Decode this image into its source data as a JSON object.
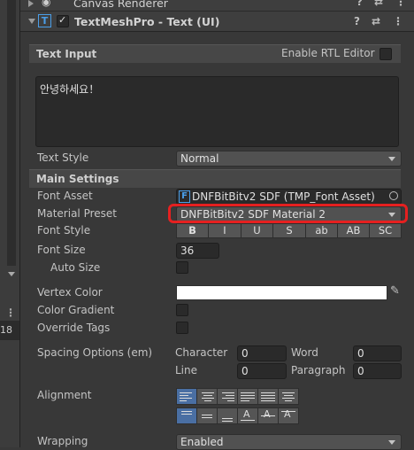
{
  "prev_component": {
    "name": "Canvas Renderer"
  },
  "component": {
    "name": "TextMeshPro - Text (UI)",
    "enabled": true
  },
  "left_panel": {
    "number": "18"
  },
  "text_input": {
    "section_title": "Text Input",
    "rtl_label": "Enable RTL Editor",
    "rtl_enabled": false,
    "value": "안녕하세요！"
  },
  "text_style": {
    "label": "Text Style",
    "value": "Normal"
  },
  "main_settings": {
    "section_title": "Main Settings",
    "font_asset": {
      "label": "Font Asset",
      "value": "DNFBitBitv2 SDF (TMP_Font Asset)"
    },
    "material_preset": {
      "label": "Material Preset",
      "value": "DNFBitBitv2 SDF Material 2"
    },
    "font_style": {
      "label": "Font Style",
      "buttons": [
        "B",
        "I",
        "U",
        "S",
        "ab",
        "AB",
        "SC"
      ]
    },
    "font_size": {
      "label": "Font Size",
      "value": "36"
    },
    "auto_size": {
      "label": "Auto Size",
      "checked": false
    },
    "vertex_color": {
      "label": "Vertex Color",
      "color": "#ffffff"
    },
    "color_gradient": {
      "label": "Color Gradient",
      "checked": false
    },
    "override_tags": {
      "label": "Override Tags",
      "checked": false
    },
    "spacing": {
      "label": "Spacing Options (em)",
      "character_label": "Character",
      "character_value": "0",
      "word_label": "Word",
      "word_value": "0",
      "line_label": "Line",
      "line_value": "0",
      "paragraph_label": "Paragraph",
      "paragraph_value": "0"
    },
    "alignment": {
      "label": "Alignment"
    },
    "wrapping": {
      "label": "Wrapping",
      "value": "Enabled"
    }
  },
  "colors": {
    "highlight": "#e52020",
    "accent": "#4a6fa3"
  }
}
